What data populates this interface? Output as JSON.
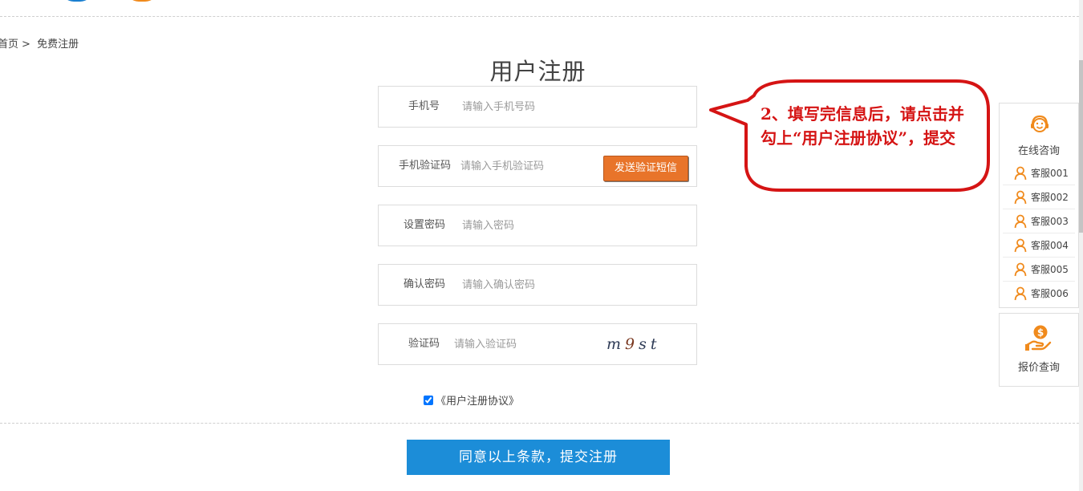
{
  "breadcrumb": {
    "home": "首页",
    "separator": ">",
    "current": "免费注册"
  },
  "page_title": "用户注册",
  "form": {
    "phone": {
      "label": "手机号",
      "placeholder": "请输入手机号码",
      "value": ""
    },
    "sms_code": {
      "label": "手机验证码",
      "placeholder": "请输入手机验证码",
      "value": "",
      "send_button": "发送验证短信"
    },
    "password": {
      "label": "设置密码",
      "placeholder": "请输入密码",
      "value": ""
    },
    "confirm_password": {
      "label": "确认密码",
      "placeholder": "请输入确认密码",
      "value": ""
    },
    "captcha": {
      "label": "验证码",
      "placeholder": "请输入验证码",
      "value": "",
      "image_text_a": "m",
      "image_text_b": "9",
      "image_text_c": "st"
    },
    "agreement": {
      "checked": true,
      "label": "《用户注册协议》"
    },
    "submit_label": "同意以上条款，提交注册"
  },
  "callout": {
    "text": "2、填写完信息后，请点击并勾上“用户注册协议”，提交",
    "color": "#d51414"
  },
  "side_panel": {
    "consult_label": "在线咨询",
    "agents": [
      "客服001",
      "客服002",
      "客服003",
      "客服004",
      "客服005",
      "客服006"
    ],
    "quote_label": "报价查询"
  },
  "colors": {
    "accent_orange": "#e8742a",
    "submit_blue": "#1c8dd8",
    "icon_orange": "#f08a1c"
  },
  "icons": {
    "consult": "headset-smile-icon",
    "agent": "user-icon",
    "quote": "hand-coin-icon"
  }
}
